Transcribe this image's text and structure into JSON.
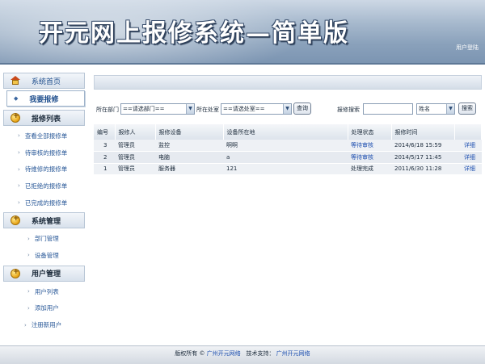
{
  "header": {
    "title": "开元网上报修系统—简单版",
    "login_link": "用户登陆"
  },
  "sidebar": {
    "home": "系统首页",
    "my_report": "我要报修",
    "sections": [
      {
        "title": "报修列表",
        "items": [
          "查看全部报修单",
          "待审核的报修单",
          "待维修的报修单",
          "已拒绝的报修单",
          "已完成的报修单"
        ]
      },
      {
        "title": "系统管理",
        "items": [
          "部门管理",
          "设备管理"
        ]
      },
      {
        "title": "用户管理",
        "items": [
          "用户列表",
          "添加用户",
          "注册新用户"
        ]
      }
    ]
  },
  "search": {
    "dept_label": "所在部门",
    "dept_value": "==请选部门==",
    "room_label": "所在处室",
    "room_value": "==请选处室==",
    "query_button": "查询",
    "keyword_label": "报修搜索",
    "keyword_value": "",
    "field_value": "姓名",
    "search_button": "搜索"
  },
  "table": {
    "columns": [
      "编号",
      "报修人",
      "报修设备",
      "设备所在地",
      "处理状态",
      "报修时间",
      ""
    ],
    "rows": [
      {
        "id": "3",
        "reporter": "管理员",
        "device": "监控",
        "location": "啊啊",
        "status": "等待审核",
        "time": "2014/6/18 15:59",
        "action": "详细"
      },
      {
        "id": "2",
        "reporter": "管理员",
        "device": "电脑",
        "location": "a",
        "status": "等待审核",
        "time": "2014/5/17 11:45",
        "action": "详细"
      },
      {
        "id": "1",
        "reporter": "管理员",
        "device": "服务器",
        "location": "121",
        "status": "处理完成",
        "time": "2011/6/30 11:28",
        "action": "详细"
      }
    ]
  },
  "footer": {
    "copyright_prefix": "版权所有 ©",
    "copyright_owner": "广州开元网络",
    "support_label": "技术支持：",
    "support_owner": "广州开元网络"
  },
  "colors": {
    "header_bg": "#8aa1bb",
    "link_blue": "#1d4fb0",
    "icon_gold": "#e8a314"
  }
}
